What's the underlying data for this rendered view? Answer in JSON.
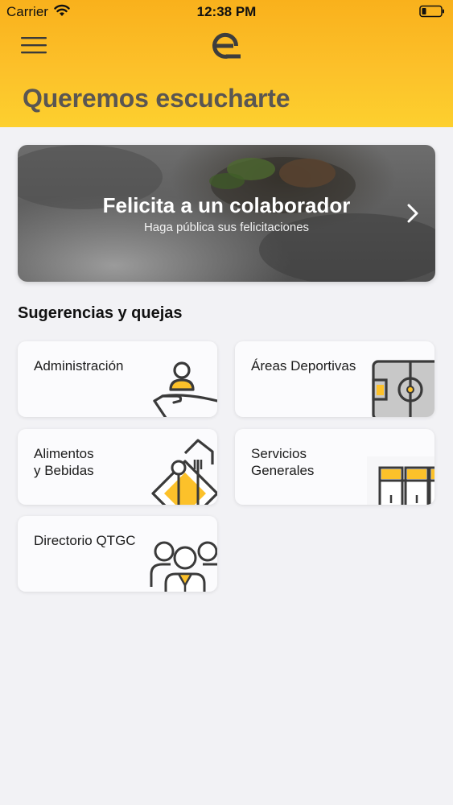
{
  "status_bar": {
    "carrier": "Carrier",
    "time": "12:38 PM"
  },
  "header": {
    "menu_icon": "hamburger-menu-icon",
    "logo_icon": "q-logo-icon",
    "title": "Queremos escucharte",
    "background_color": "#fcc12a"
  },
  "hero": {
    "title": "Felicita a un colaborador",
    "subtitle": "Haga pública sus felicitaciones",
    "chevron_icon": "chevron-right-icon"
  },
  "section": {
    "title": "Sugerencias y quejas"
  },
  "categories": [
    {
      "label": "Administración",
      "icon": "person-hand-icon"
    },
    {
      "label": "Áreas Deportivas",
      "icon": "soccer-field-icon"
    },
    {
      "label": "Alimentos\ny Bebidas",
      "icon": "food-sign-icon"
    },
    {
      "label": "Servicios\nGenerales",
      "icon": "lockers-icon"
    },
    {
      "label": "Directorio QTGC",
      "icon": "people-group-icon"
    }
  ],
  "accent_color": "#fcc12a",
  "icon_stroke_color": "#3a3a3a"
}
